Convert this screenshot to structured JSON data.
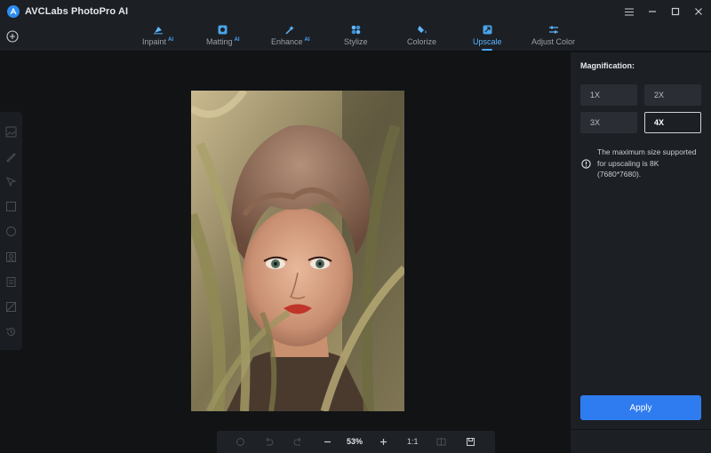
{
  "app": {
    "title": "AVCLabs PhotoPro AI"
  },
  "tabs": [
    {
      "label": "Inpaint",
      "ai": "AI",
      "icon": "inpaint-icon"
    },
    {
      "label": "Matting",
      "ai": "AI",
      "icon": "matting-icon"
    },
    {
      "label": "Enhance",
      "ai": "AI",
      "icon": "enhance-icon"
    },
    {
      "label": "Stylize",
      "ai": "",
      "icon": "stylize-icon"
    },
    {
      "label": "Colorize",
      "ai": "",
      "icon": "colorize-icon"
    },
    {
      "label": "Upscale",
      "ai": "",
      "icon": "upscale-icon",
      "active": true
    },
    {
      "label": "Adjust Color",
      "ai": "",
      "icon": "adjust-color-icon"
    }
  ],
  "bottom_bar": {
    "zoom": "53%",
    "ratio": "1:1"
  },
  "panel": {
    "title": "Magnification:",
    "options": [
      "1X",
      "2X",
      "3X",
      "4X"
    ],
    "selected": "4X",
    "info": "The maximum size supported for upscaling is 8K (7680*7680).",
    "apply_label": "Apply"
  },
  "colors": {
    "accent": "#49a7ff",
    "apply": "#2f7cf0",
    "background": "#111315",
    "panel": "#1c1f24"
  }
}
